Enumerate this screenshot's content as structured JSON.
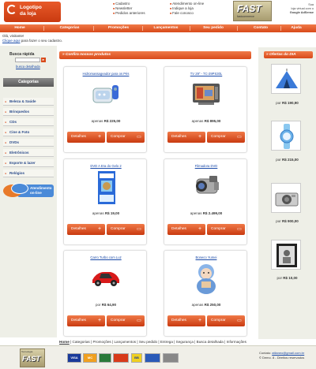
{
  "header": {
    "logo_line1": "Logotipo",
    "logo_line2": "da loja",
    "topnav_col1": [
      "Cadastro",
      "Newsletter",
      "Pedidos anteriores"
    ],
    "topnav_col2": [
      "Atendimento on-line",
      "Indique a loja",
      "Fale conosco"
    ],
    "fast_logo": "FAST",
    "fast_sub": "fastcommerce",
    "ads_line1": "Sua",
    "ads_line2": "loja virtual com o",
    "ads_line3": "Google AdSense"
  },
  "mainnav": [
    "Home",
    "Categorias",
    "Promoções",
    "Lançamentos",
    "Seu pedido",
    "Contato",
    "Ajuda"
  ],
  "welcome": {
    "line1": "Olá, visitante!",
    "link": "Clique aqui",
    "rest": " para fazer o seu cadastro."
  },
  "search": {
    "title": "Busca rápida",
    "go": "►",
    "link": "busca detalhada"
  },
  "categories": {
    "title": "Categorias",
    "items": [
      "Beleza & Saúde",
      "Brinquedos",
      "CDs",
      "Cine & Foto",
      "DVDs",
      "Eletrônicos",
      "Esporte & lazer",
      "Relógios"
    ]
  },
  "chat": {
    "line1": "Atendimento",
    "line2": "on-line"
  },
  "main": {
    "section_title": "» Confira nossos produtos",
    "products": [
      {
        "name": "Hidromassageador para os Pés",
        "price_prefix": "apenas ",
        "price": "R$ 225,00"
      },
      {
        "name": "TV 29\" - TC-29PS30L",
        "price_prefix": "apenas ",
        "price": "R$ 895,00"
      },
      {
        "name": "DVD A Era do Gelo 2",
        "price_prefix": "apenas ",
        "price": "R$ 19,00"
      },
      {
        "name": "Filmadora DVD",
        "price_prefix": "apenas ",
        "price": "R$ 2.499,00"
      },
      {
        "name": "Carro Turbo com Luz",
        "price_prefix": "por ",
        "price": "R$ 64,90"
      },
      {
        "name": "Boneco Yumei",
        "price_prefix": "apenas ",
        "price": "R$ 250,00"
      }
    ],
    "btn_details": "Detalhes",
    "btn_buy": "Comprar",
    "plus_icon": "+",
    "cart_icon": "🛒"
  },
  "offers": {
    "title": "» Ofertas do DIA",
    "items": [
      {
        "prefix": "por ",
        "price": "R$ 190,90"
      },
      {
        "prefix": "por ",
        "price": "R$ 215,00"
      },
      {
        "prefix": "por ",
        "price": "R$ 900,00"
      },
      {
        "prefix": "por ",
        "price": "R$ 10,00"
      }
    ]
  },
  "footer": {
    "links": [
      "Home",
      "Categorias",
      "Promoções",
      "Lançamentos",
      "Seu pedido",
      "Entrega",
      "Segurança",
      "Busca detalhada",
      "Informações"
    ],
    "separator": " | ",
    "powered": "Tecnologia",
    "fast": "FAST",
    "payments": [
      "VISA",
      "MC",
      "",
      "",
      "BB",
      "",
      ""
    ],
    "contact_label": "Contato: ",
    "contact_email": "atilaneo@gmail.com.br",
    "copyright": "© Demo. 8 - Direitos reservados"
  }
}
